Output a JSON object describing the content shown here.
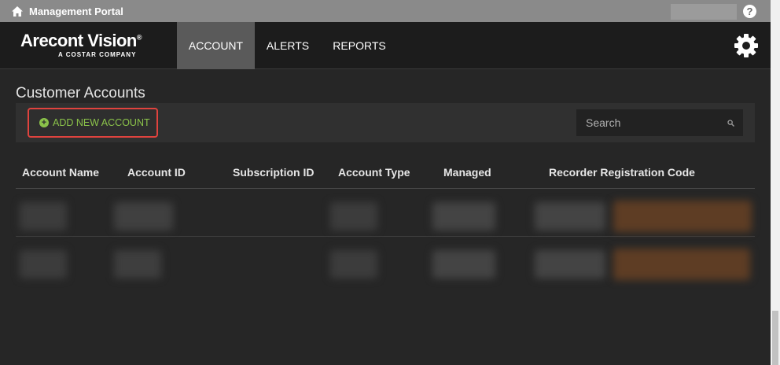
{
  "portal": {
    "title": "Management Portal",
    "help": "?"
  },
  "logo": {
    "main": "Arecont Vision",
    "reg": "®",
    "sub": "A COSTAR COMPANY"
  },
  "nav": {
    "tabs": [
      {
        "label": "ACCOUNT",
        "active": true
      },
      {
        "label": "ALERTS",
        "active": false
      },
      {
        "label": "REPORTS",
        "active": false
      }
    ]
  },
  "page": {
    "title": "Customer Accounts"
  },
  "toolbar": {
    "add_label": "ADD NEW ACCOUNT",
    "search_placeholder": "Search"
  },
  "table": {
    "columns": [
      "Account Name",
      "Account ID",
      "Subscription ID",
      "Account Type",
      "Managed",
      "Recorder Registration Code"
    ]
  },
  "colors": {
    "accent_green": "#8bc34a",
    "highlight_red": "#e0433e",
    "nav_active": "#5a5a5a"
  }
}
